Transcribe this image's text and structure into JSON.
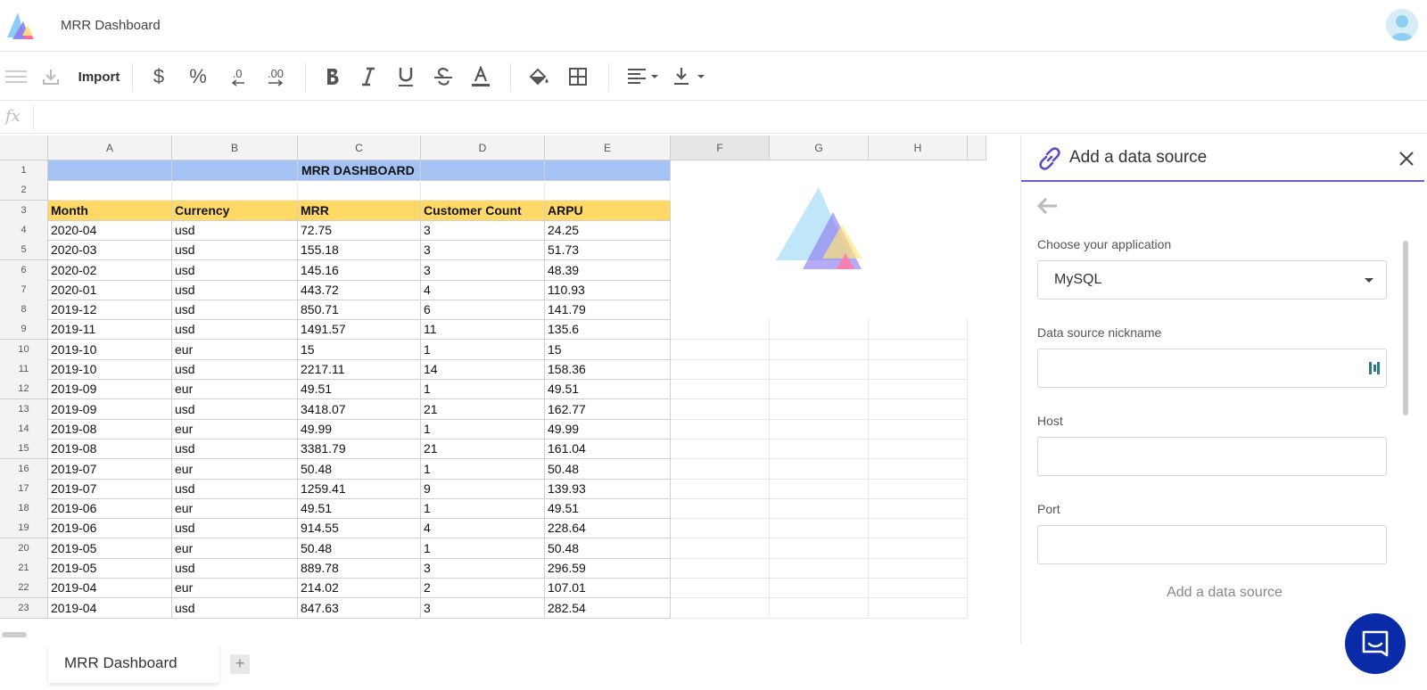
{
  "app": {
    "title": "MRR Dashboard"
  },
  "toolbar": {
    "import_label": "Import",
    "dollar": "$",
    "percent": "%",
    "decrease_decimal": ".0",
    "increase_decimal": ".00"
  },
  "formula_bar": {
    "fx": "fx"
  },
  "sheet": {
    "columns": [
      "A",
      "B",
      "C",
      "D",
      "E",
      "F",
      "G",
      "H"
    ],
    "selected_column": "F",
    "title": "MRR DASHBOARD",
    "headers": [
      "Month",
      "Currency",
      "MRR",
      "Customer Count",
      "ARPU"
    ],
    "rows": [
      [
        "2020-04",
        "usd",
        "72.75",
        "3",
        "24.25"
      ],
      [
        "2020-03",
        "usd",
        "155.18",
        "3",
        "51.73"
      ],
      [
        "2020-02",
        "usd",
        "145.16",
        "3",
        "48.39"
      ],
      [
        "2020-01",
        "usd",
        "443.72",
        "4",
        "110.93"
      ],
      [
        "2019-12",
        "usd",
        "850.71",
        "6",
        "141.79"
      ],
      [
        "2019-11",
        "usd",
        "1491.57",
        "11",
        "135.6"
      ],
      [
        "2019-10",
        "eur",
        "15",
        "1",
        "15"
      ],
      [
        "2019-10",
        "usd",
        "2217.11",
        "14",
        "158.36"
      ],
      [
        "2019-09",
        "eur",
        "49.51",
        "1",
        "49.51"
      ],
      [
        "2019-09",
        "usd",
        "3418.07",
        "21",
        "162.77"
      ],
      [
        "2019-08",
        "eur",
        "49.99",
        "1",
        "49.99"
      ],
      [
        "2019-08",
        "usd",
        "3381.79",
        "21",
        "161.04"
      ],
      [
        "2019-07",
        "eur",
        "50.48",
        "1",
        "50.48"
      ],
      [
        "2019-07",
        "usd",
        "1259.41",
        "9",
        "139.93"
      ],
      [
        "2019-06",
        "eur",
        "49.51",
        "1",
        "49.51"
      ],
      [
        "2019-06",
        "usd",
        "914.55",
        "4",
        "228.64"
      ],
      [
        "2019-05",
        "eur",
        "50.48",
        "1",
        "50.48"
      ],
      [
        "2019-05",
        "usd",
        "889.78",
        "3",
        "296.59"
      ],
      [
        "2019-04",
        "eur",
        "214.02",
        "2",
        "107.01"
      ],
      [
        "2019-04",
        "usd",
        "847.63",
        "3",
        "282.54"
      ]
    ],
    "row_numbers": [
      "1",
      "2",
      "3",
      "4",
      "5",
      "6",
      "7",
      "8",
      "9",
      "10",
      "11",
      "12",
      "13",
      "14",
      "15",
      "16",
      "17",
      "18",
      "19",
      "20",
      "21",
      "22",
      "23"
    ]
  },
  "panel": {
    "title": "Add a data source",
    "application_label": "Choose your application",
    "application_value": "MySQL",
    "nickname_label": "Data source nickname",
    "nickname_value": "",
    "host_label": "Host",
    "host_value": "",
    "port_label": "Port",
    "port_value": "",
    "submit_label": "Add a data source"
  },
  "tabs": {
    "sheet_name": "MRR Dashboard",
    "add": "+"
  },
  "colors": {
    "title_fill": "#a4c2f4",
    "header_fill": "#ffd966",
    "panel_accent": "#6a5bd7",
    "chat_bubble": "#0a2ba8"
  },
  "icons": [
    "logo",
    "avatar-icon",
    "menu-icon",
    "download-icon",
    "bold-icon",
    "italic-icon",
    "underline-icon",
    "strikethrough-icon",
    "text-color-icon",
    "fill-color-icon",
    "borders-icon",
    "align-left-icon",
    "valign-bottom-icon",
    "link-icon",
    "close-icon",
    "arrow-left-icon",
    "chat-icon"
  ]
}
